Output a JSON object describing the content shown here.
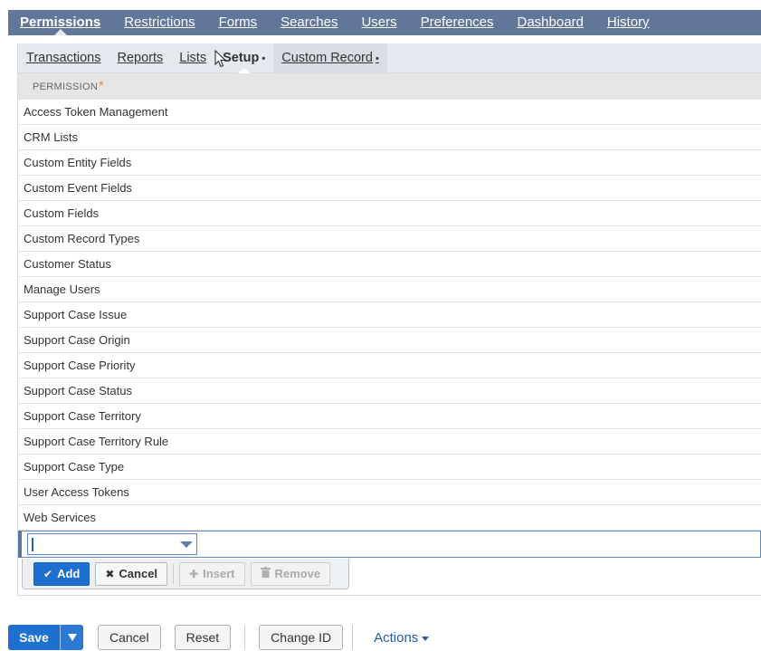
{
  "main_tabs": [
    {
      "label": "Permissions",
      "active": true
    },
    {
      "label": "Restrictions",
      "active": false
    },
    {
      "label": "Forms",
      "active": false
    },
    {
      "label": "Searches",
      "active": false
    },
    {
      "label": "Users",
      "active": false
    },
    {
      "label": "Preferences",
      "active": false
    },
    {
      "label": "Dashboard",
      "active": false
    },
    {
      "label": "History",
      "active": false
    }
  ],
  "sub_tabs": [
    {
      "label": "Transactions"
    },
    {
      "label": "Reports"
    },
    {
      "label": "Lists"
    },
    {
      "label": "Setup",
      "dot": "•"
    },
    {
      "label": "Custom Record",
      "dot": "•"
    }
  ],
  "table": {
    "column_header": "PERMISSION",
    "required_mark": "*",
    "rows": [
      "Access Token Management",
      "CRM Lists",
      "Custom Entity Fields",
      "Custom Event Fields",
      "Custom Fields",
      "Custom Record Types",
      "Customer Status",
      "Manage Users",
      "Support Case Issue",
      "Support Case Origin",
      "Support Case Priority",
      "Support Case Status",
      "Support Case Territory",
      "Support Case Territory Rule",
      "Support Case Type",
      "User Access Tokens",
      "Web Services"
    ],
    "edit_value": ""
  },
  "line_buttons": {
    "add": "Add",
    "cancel": "Cancel",
    "insert": "Insert",
    "remove": "Remove"
  },
  "footer": {
    "save": "Save",
    "cancel": "Cancel",
    "reset": "Reset",
    "change_id": "Change ID",
    "actions": "Actions"
  },
  "colors": {
    "tab_bar": "#607799",
    "primary_button": "#1d6fd0",
    "required": "#e87d1e",
    "link": "#2a5aa5"
  }
}
